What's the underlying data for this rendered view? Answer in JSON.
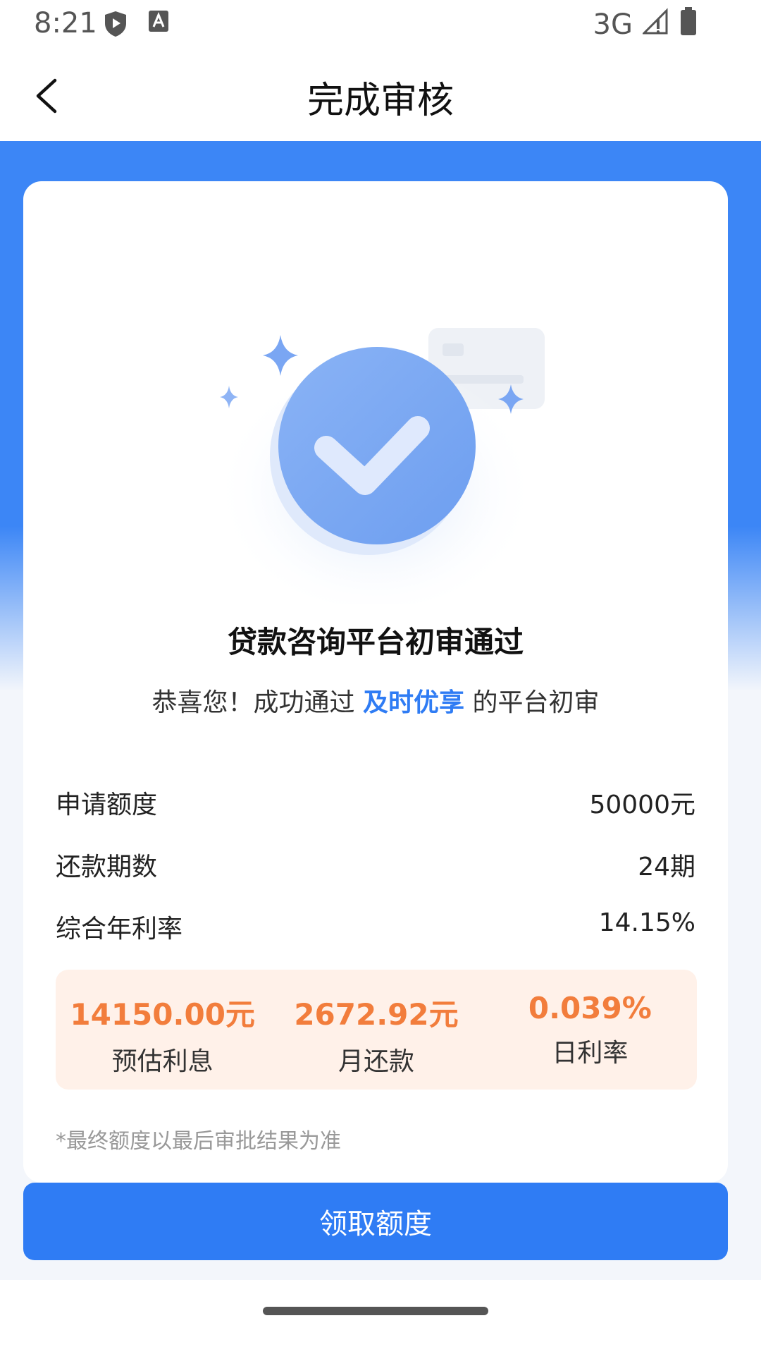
{
  "status_bar": {
    "time": "8:21",
    "network": "3G",
    "icons": [
      "shield-play-icon",
      "font-a-icon",
      "signal-icon",
      "battery-icon"
    ]
  },
  "header": {
    "title": "完成审核",
    "back_icon": "chevron-left-icon"
  },
  "result": {
    "title": "贷款咨询平台初审通过",
    "subtitle_prefix": "恭喜您！成功通过 ",
    "platform_name": "及时优享",
    "subtitle_suffix": " 的平台初审"
  },
  "details": [
    {
      "label": "申请额度",
      "value": "50000元"
    },
    {
      "label": "还款期数",
      "value": "24期"
    },
    {
      "label": "综合年利率",
      "value": "14.15%"
    }
  ],
  "summary": [
    {
      "value": "14150.00元",
      "label": "预估利息"
    },
    {
      "value": "2672.92元",
      "label": "月还款"
    },
    {
      "value": "0.039%",
      "label": "日利率"
    }
  ],
  "note": "*最终额度以最后审批结果为准",
  "button": {
    "label": "领取额度"
  },
  "colors": {
    "brand_blue": "#2f7cf4",
    "accent_orange": "#f27d3c",
    "summary_bg": "#fff1e9"
  }
}
